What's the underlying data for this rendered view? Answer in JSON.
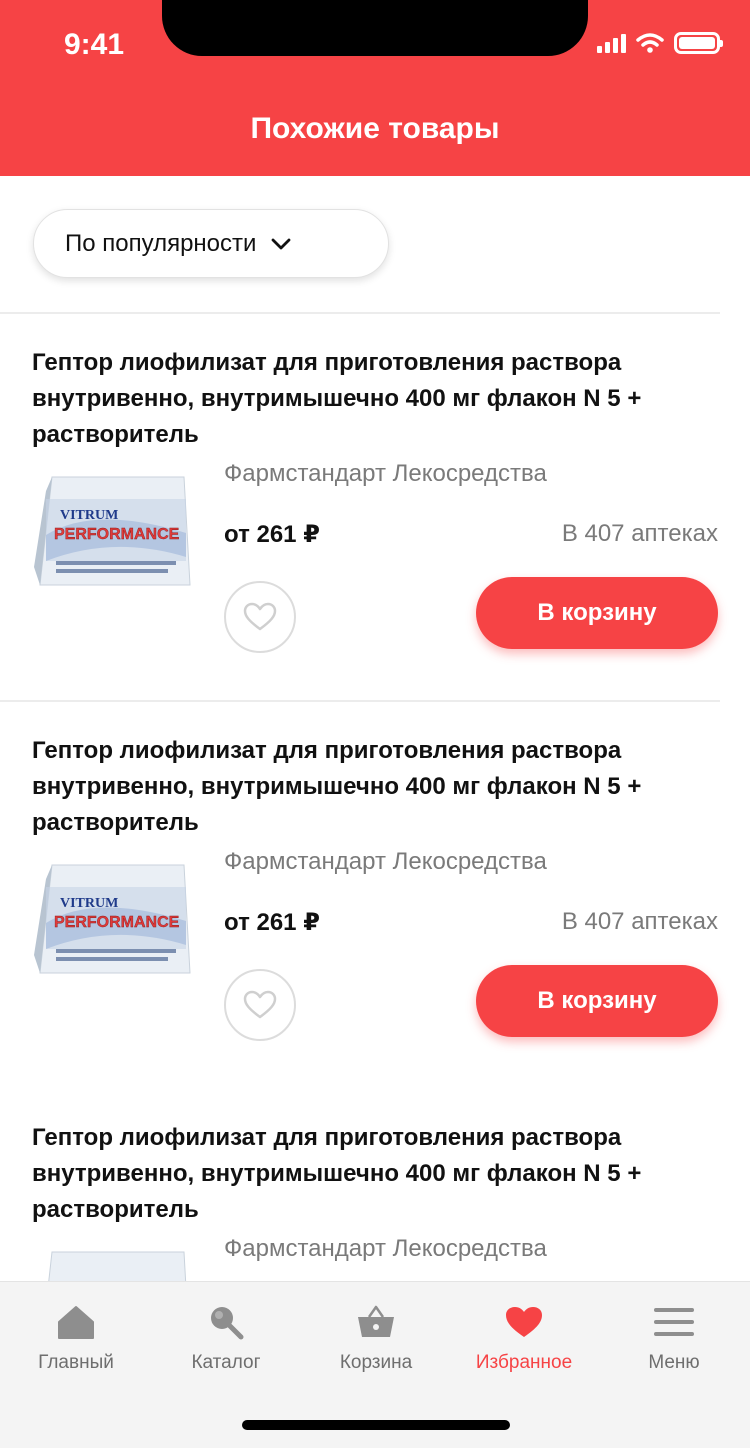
{
  "status": {
    "time": "9:41"
  },
  "header": {
    "title": "Похожие товары"
  },
  "sort": {
    "label": "По популярности"
  },
  "products": [
    {
      "title": "Гептор лиофилизат для приготовления раствора внутривенно, внутримышечно 400 мг флакон N 5 + растворитель",
      "manufacturer": "Фармстандарт Лекосредства",
      "price": "от 261 ₽",
      "availability": "В 407 аптеках",
      "cart_label": "В корзину",
      "image_brand": "VITRUM",
      "image_name": "PERFORMANCE"
    },
    {
      "title": "Гептор лиофилизат для приготовления раствора внутривенно, внутримышечно 400 мг флакон N 5 + растворитель",
      "manufacturer": "Фармстандарт Лекосредства",
      "price": "от 261 ₽",
      "availability": "В 407 аптеках",
      "cart_label": "В корзину",
      "image_brand": "VITRUM",
      "image_name": "PERFORMANCE"
    },
    {
      "title": "Гептор лиофилизат для приготовления раствора внутривенно, внутримышечно 400 мг флакон N 5 + растворитель",
      "manufacturer": "Фармстандарт Лекосредства",
      "price": "",
      "availability": "",
      "cart_label": "",
      "image_brand": "",
      "image_name": ""
    }
  ],
  "tabbar": {
    "items": [
      {
        "label": "Главный",
        "icon": "home-icon"
      },
      {
        "label": "Каталог",
        "icon": "search-icon"
      },
      {
        "label": "Корзина",
        "icon": "basket-icon"
      },
      {
        "label": "Избранное",
        "icon": "heart-icon",
        "active": true
      },
      {
        "label": "Меню",
        "icon": "menu-icon"
      }
    ]
  },
  "colors": {
    "accent": "#f64345",
    "muted": "#7a7a7a",
    "icon_gray": "#8e8e8e"
  }
}
